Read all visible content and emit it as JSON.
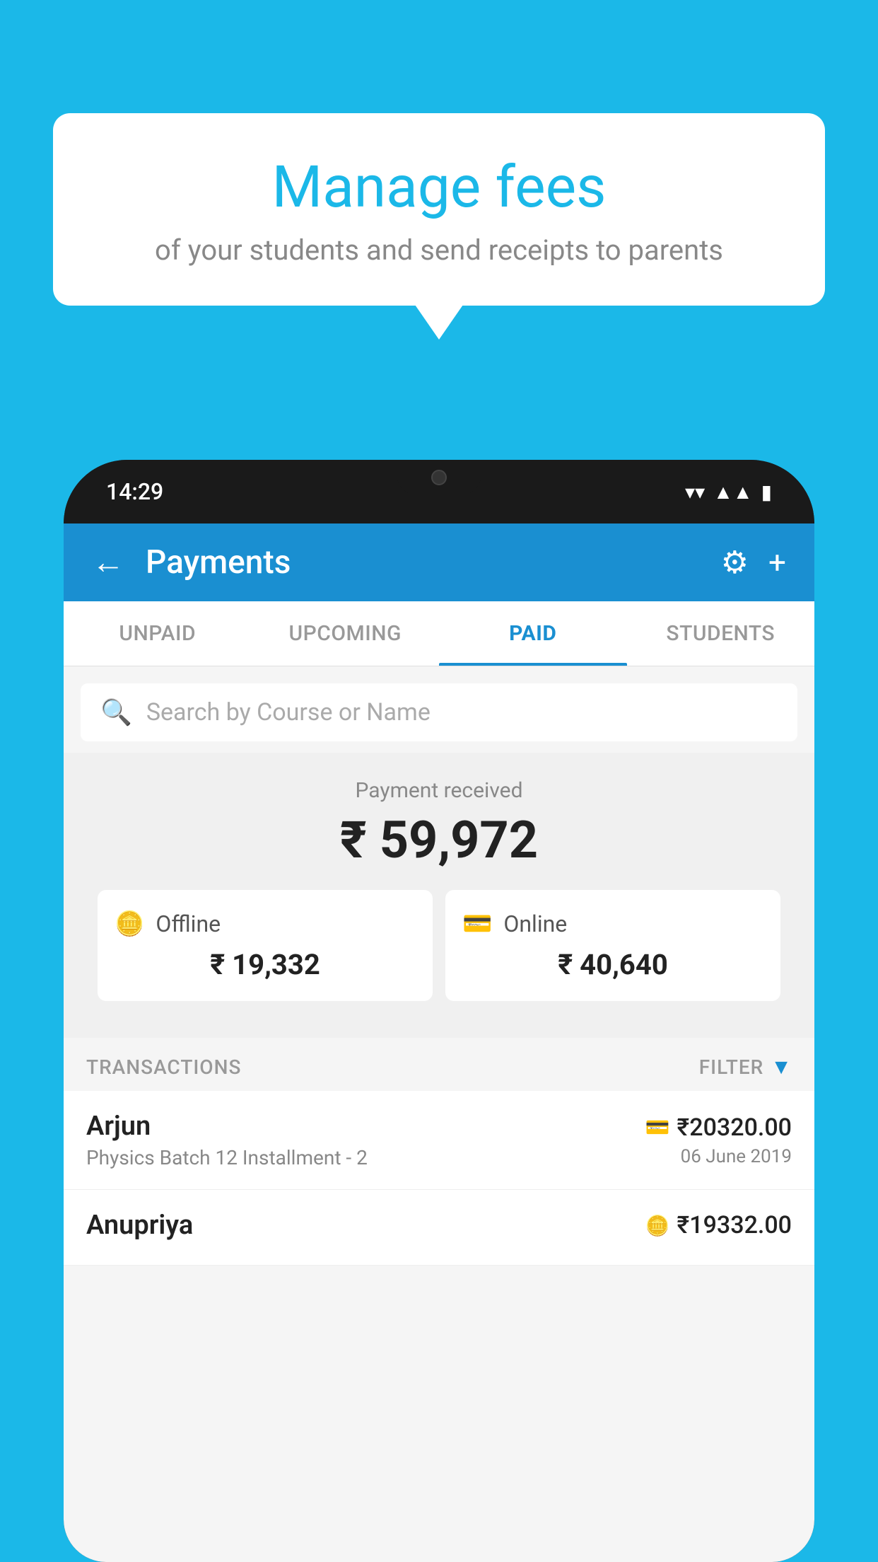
{
  "background_color": "#1BB8E8",
  "bubble": {
    "title": "Manage fees",
    "subtitle": "of your students and send receipts to parents"
  },
  "phone": {
    "status": {
      "time": "14:29"
    },
    "header": {
      "title": "Payments",
      "back_label": "←",
      "gear_label": "⚙",
      "plus_label": "+"
    },
    "tabs": [
      {
        "label": "UNPAID",
        "active": false
      },
      {
        "label": "UPCOMING",
        "active": false
      },
      {
        "label": "PAID",
        "active": true
      },
      {
        "label": "STUDENTS",
        "active": false
      }
    ],
    "search": {
      "placeholder": "Search by Course or Name"
    },
    "payment_summary": {
      "label": "Payment received",
      "amount": "₹ 59,972",
      "offline": {
        "label": "Offline",
        "amount": "₹ 19,332",
        "icon": "offline"
      },
      "online": {
        "label": "Online",
        "amount": "₹ 40,640",
        "icon": "online"
      }
    },
    "transactions": {
      "header_label": "TRANSACTIONS",
      "filter_label": "FILTER",
      "rows": [
        {
          "name": "Arjun",
          "detail": "Physics Batch 12 Installment - 2",
          "amount": "₹20320.00",
          "date": "06 June 2019",
          "payment_type": "card"
        },
        {
          "name": "Anupriya",
          "detail": "",
          "amount": "₹19332.00",
          "date": "",
          "payment_type": "offline"
        }
      ]
    }
  }
}
